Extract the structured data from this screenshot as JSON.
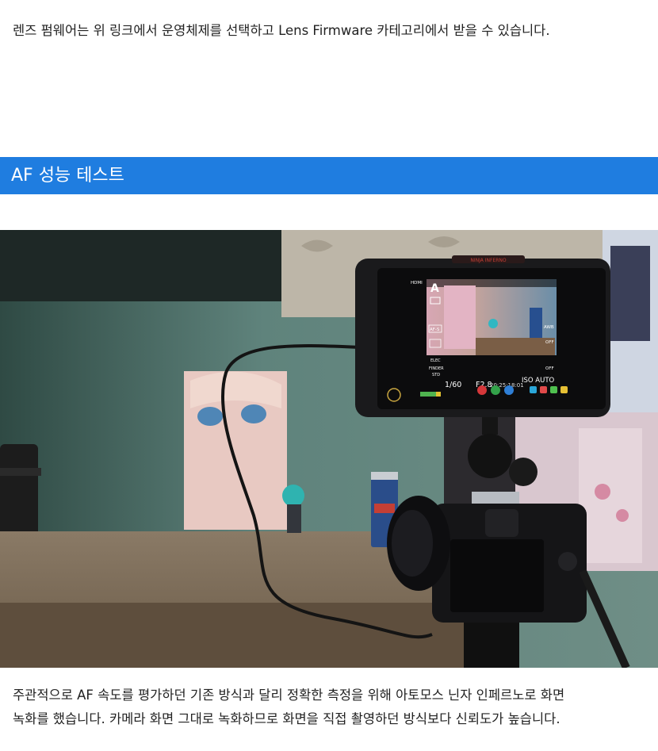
{
  "intro_text": "렌즈 펌웨어는 위 링크에서 운영체제를 선택하고 Lens Firmware 카테고리에서 받을 수 있습니다.",
  "section_title": "AF 성능 테스트",
  "monitor": {
    "input_label": "HDMI",
    "shutter": "1/60",
    "aperture": "F2.8",
    "iso": "ISO AUTO",
    "timecode": "20:25:18:01",
    "af_mode": "AF-S",
    "awb": "AWB",
    "off1": "OFF",
    "off2": "OFF",
    "elec": "ELEC",
    "finder": "FINDER",
    "std": "STD",
    "brand": "NINJA INFERNO"
  },
  "caption_lines": [
    "주관적으로 AF 속도를 평가하던 기존 방식과 달리 정확한 측정을 위해 아토모스 닌자 인페르노로 화면",
    "녹화를 했습니다. 카메라 화면 그대로 녹화하므로 화면을 직접 촬영하던 방식보다 신뢰도가 높습니다."
  ]
}
